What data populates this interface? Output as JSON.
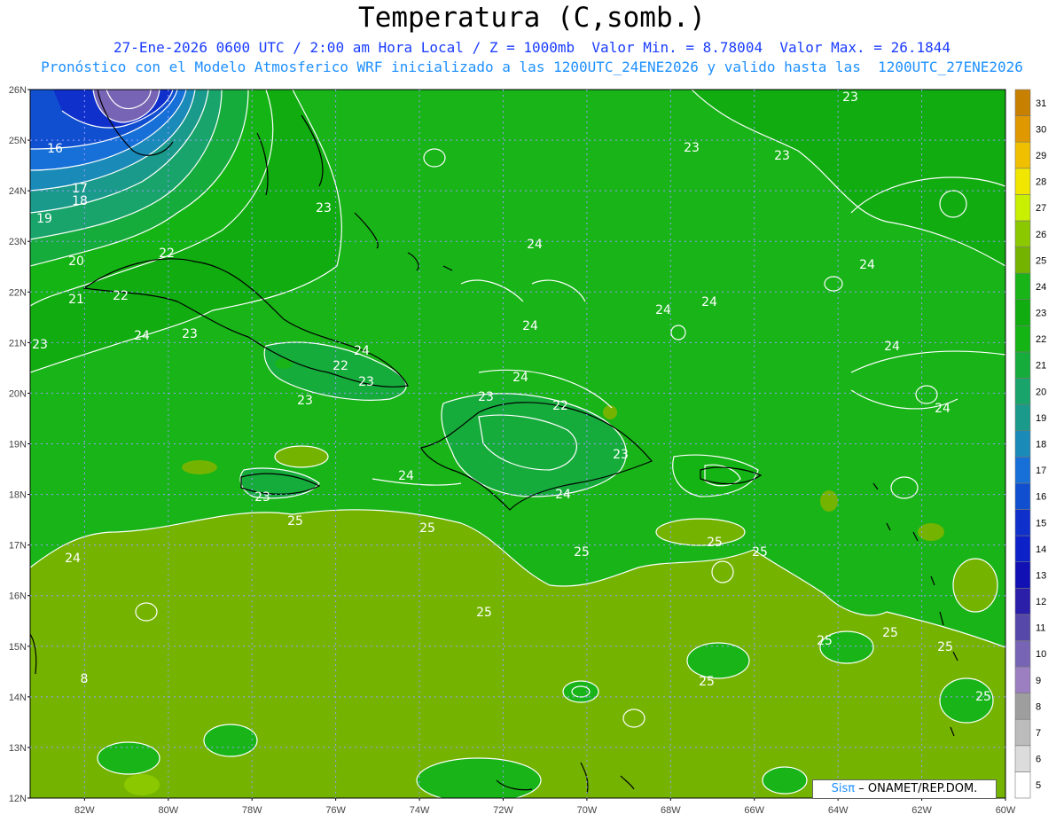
{
  "header": {
    "title": "Temperatura (C,somb.)",
    "line1_date": "27-Ene-2026 0600 UTC / 2:00 am Hora Local / Z = 1000mb",
    "line1_minmax": "Valor Min. = 8.78004  Valor Max. = 26.1844",
    "line2": "Pronóstico con el Modelo Atmosferico WRF inicializado a las 1200UTC_24ENE2026 y valido hasta las  1200UTC_27ENE2026"
  },
  "axes": {
    "lat_labels": [
      "26N",
      "25N",
      "24N",
      "23N",
      "22N",
      "21N",
      "20N",
      "19N",
      "18N",
      "17N",
      "16N",
      "15N",
      "14N",
      "13N",
      "12N"
    ],
    "lon_labels": [
      "82W",
      "80W",
      "78W",
      "76W",
      "74W",
      "72W",
      "70W",
      "68W",
      "66W",
      "64W",
      "62W",
      "60W"
    ]
  },
  "colorbar": {
    "labels": [
      "5",
      "6",
      "7",
      "8",
      "9",
      "10",
      "11",
      "12",
      "13",
      "14",
      "15",
      "16",
      "17",
      "18",
      "19",
      "20",
      "21",
      "22",
      "23",
      "24",
      "25",
      "26",
      "27",
      "28",
      "29",
      "30",
      "31"
    ],
    "colors": [
      "#ffffff",
      "#dcdcdc",
      "#bcbcbc",
      "#9e9e9e",
      "#9b7fc0",
      "#7764b4",
      "#5548a8",
      "#2b1ea8",
      "#1010b4",
      "#0c22c8",
      "#1030cc",
      "#1050d0",
      "#1670d8",
      "#1a8ab8",
      "#1a9a8a",
      "#18a46a",
      "#16ac3c",
      "#14b414",
      "#10ac10",
      "#18b418",
      "#74b400",
      "#8cc800",
      "#c8f000",
      "#f0e600",
      "#f0c000",
      "#e09800",
      "#c88000"
    ]
  },
  "contour_labels": [
    {
      "text": "16"
    },
    {
      "text": "17"
    },
    {
      "text": "18"
    },
    {
      "text": "19"
    },
    {
      "text": "20"
    },
    {
      "text": "21"
    },
    {
      "text": "22"
    },
    {
      "text": "22"
    },
    {
      "text": "23"
    },
    {
      "text": "23"
    },
    {
      "text": "23"
    },
    {
      "text": "23"
    },
    {
      "text": "23"
    },
    {
      "text": "24"
    },
    {
      "text": "24"
    },
    {
      "text": "24"
    },
    {
      "text": "24"
    },
    {
      "text": "24"
    },
    {
      "text": "24"
    },
    {
      "text": "24"
    },
    {
      "text": "22"
    },
    {
      "text": "23"
    },
    {
      "text": "24"
    },
    {
      "text": "23"
    },
    {
      "text": "22"
    },
    {
      "text": "23"
    },
    {
      "text": "24"
    },
    {
      "text": "24"
    },
    {
      "text": "23"
    },
    {
      "text": "25"
    },
    {
      "text": "25"
    },
    {
      "text": "25"
    },
    {
      "text": "25"
    },
    {
      "text": "25"
    },
    {
      "text": "25"
    },
    {
      "text": "25"
    },
    {
      "text": "25"
    },
    {
      "text": "25"
    },
    {
      "text": "25"
    },
    {
      "text": "8"
    },
    {
      "text": "25"
    },
    {
      "text": "24"
    },
    {
      "text": "24"
    },
    {
      "text": "24"
    },
    {
      "text": "23"
    },
    {
      "text": "23"
    }
  ],
  "credit": {
    "sis": "Sisπ",
    "text": "– ONAMET/REP.DOM."
  }
}
